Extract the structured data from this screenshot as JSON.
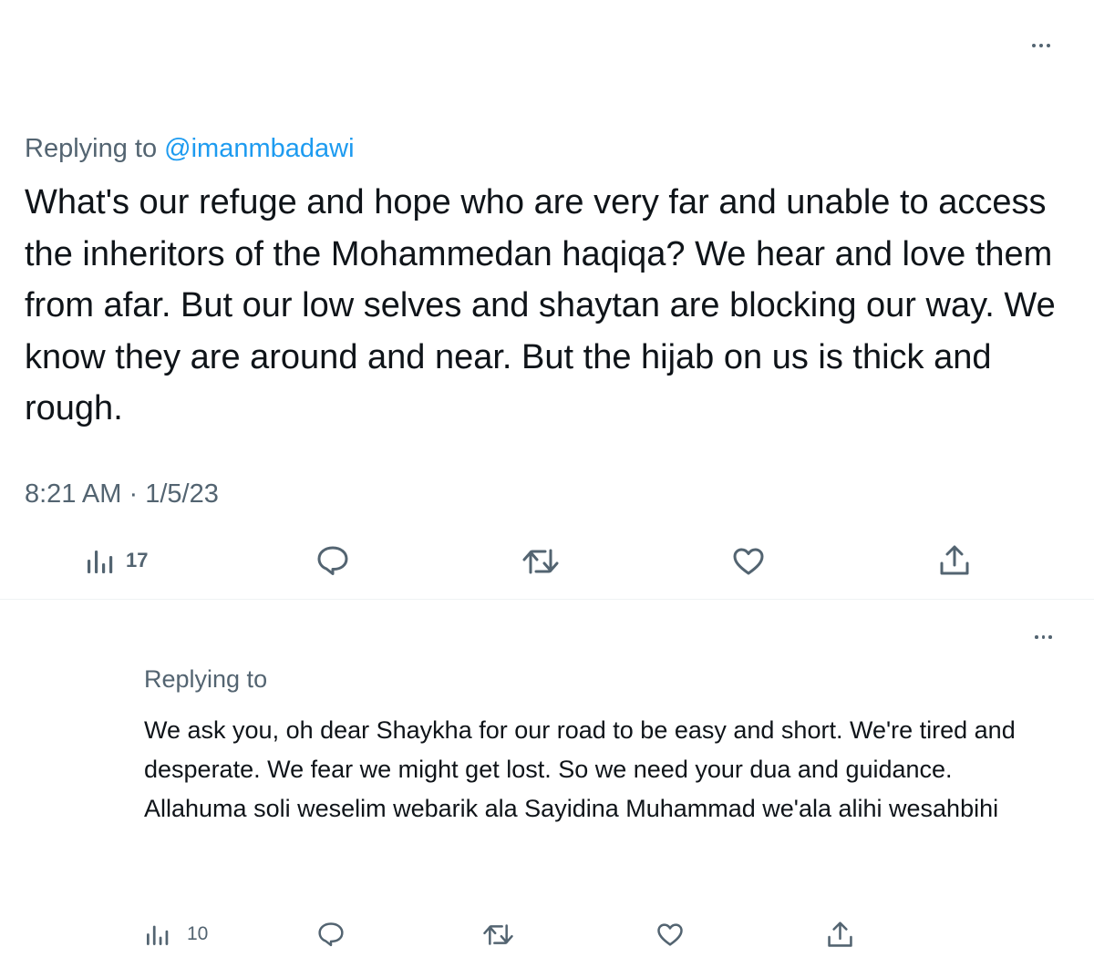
{
  "main_tweet": {
    "replying_prefix": "Replying to ",
    "replying_handle": "@imanmbadawi",
    "text": "What's our refuge and hope who are very far and unable to access the inheritors of the Mohammedan haqiqa? We hear and love them from afar. But our low selves and shaytan are blocking our way. We know they are around and near. But the hijab on us is thick and rough.",
    "time": "8:21 AM",
    "separator": "·",
    "date": "1/5/23",
    "views": "17",
    "icons": [
      "more-icon",
      "views-icon",
      "reply-icon",
      "retweet-icon",
      "like-icon",
      "share-icon"
    ]
  },
  "reply_tweet": {
    "replying_prefix": "Replying to",
    "text_lines": [
      "We ask you, oh dear Shaykha for our road to be easy and short. We're tired and desperate. We fear we might get lost. So we need your dua and guidance.",
      "Allahuma soli weselim webarik ala Sayidina Muhammad we'ala alihi wesahbihi"
    ],
    "views": "10",
    "icons": [
      "more-icon",
      "views-icon",
      "reply-icon",
      "retweet-icon",
      "like-icon",
      "share-icon"
    ]
  },
  "colors": {
    "text": "#0f1419",
    "muted": "#536471",
    "link": "#1d9bf0",
    "divider": "#eff3f4"
  }
}
